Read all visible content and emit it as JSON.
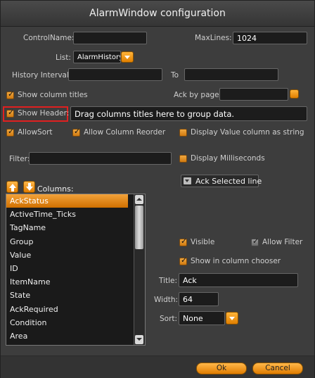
{
  "window": {
    "title": "AlarmWindow configuration"
  },
  "control_name": {
    "label": "ControlName:",
    "value": ""
  },
  "max_lines": {
    "label": "MaxLines:",
    "value": "1024"
  },
  "list": {
    "label": "List:",
    "value": "AlarmHistory"
  },
  "history_interval": {
    "label": "History Interval:",
    "from": "",
    "to_label": "To",
    "to": ""
  },
  "show_column_titles": {
    "label": "Show column titles",
    "checked": true
  },
  "ack_by_page": {
    "label": "Ack by page:",
    "value": ""
  },
  "show_header": {
    "label": "Show Header:",
    "checked": true,
    "value": "Drag columns titles here to group data."
  },
  "allow_sort": {
    "label": "AllowSort",
    "checked": true
  },
  "allow_column_reorder": {
    "label": "Allow Column Reorder",
    "checked": true
  },
  "display_value_as_string": {
    "label": "Display Value column as string",
    "checked": false
  },
  "filter": {
    "label": "Filter:",
    "value": ""
  },
  "display_milliseconds": {
    "label": "Display Milliseconds",
    "checked": false
  },
  "ack_selected": {
    "label": "Ack Selected line"
  },
  "columns": {
    "label": "Columns:",
    "items": [
      "AckStatus",
      "ActiveTime_Ticks",
      "TagName",
      "Group",
      "Value",
      "ID",
      "ItemName",
      "State",
      "AckRequired",
      "Condition",
      "Area"
    ],
    "selected": "AckStatus"
  },
  "column_props": {
    "visible": {
      "label": "Visible",
      "checked": true
    },
    "allow_filter": {
      "label": "Allow Filter",
      "checked": true
    },
    "show_in_chooser": {
      "label": "Show in column chooser",
      "checked": true
    },
    "title": {
      "label": "Title:",
      "value": "Ack"
    },
    "width": {
      "label": "Width:",
      "value": "64"
    },
    "sort": {
      "label": "Sort:",
      "value": "None"
    }
  },
  "footer": {
    "ok": "Ok",
    "cancel": "Cancel"
  },
  "colors": {
    "accent": "#f0a030",
    "highlight_border": "#e02020",
    "background": "#3d3d3d"
  }
}
